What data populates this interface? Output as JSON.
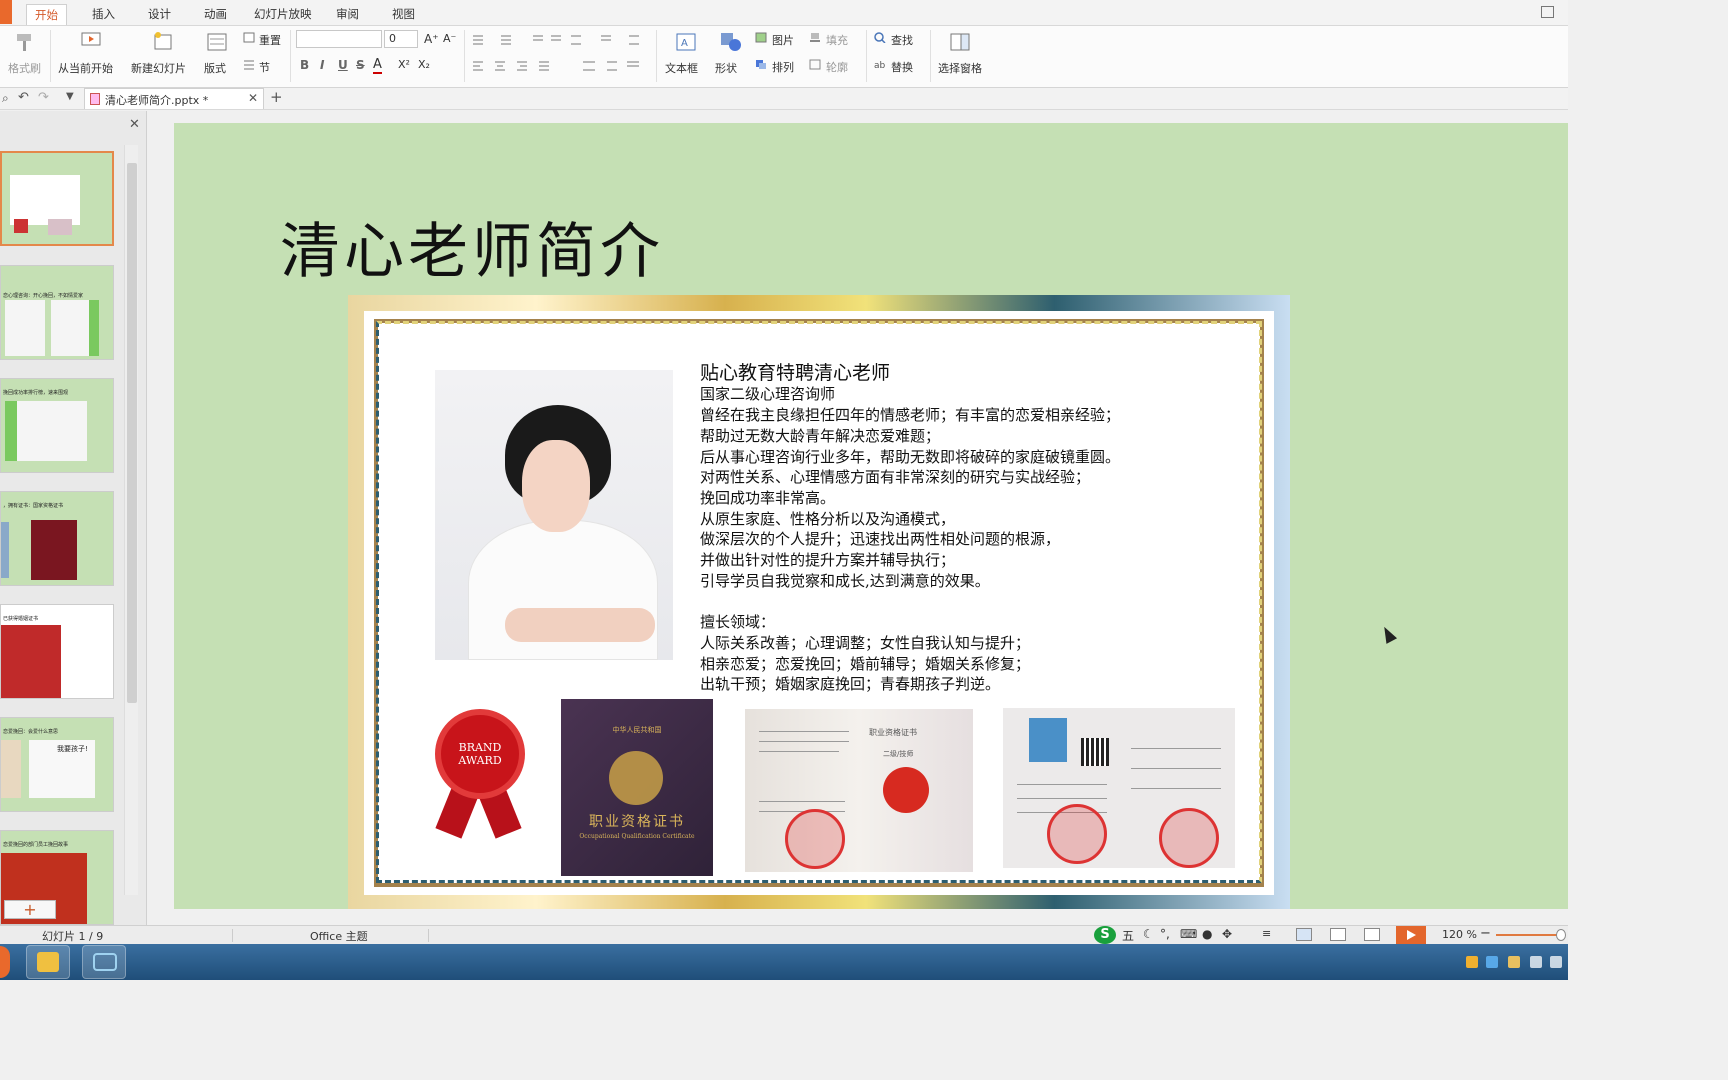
{
  "menubar": {
    "tabs": [
      "开始",
      "插入",
      "设计",
      "动画",
      "幻灯片放映",
      "审阅",
      "视图"
    ],
    "active": "开始"
  },
  "ribbon": {
    "format_painter": "格式刷",
    "from_current": "从当前开始",
    "new_slide": "新建幻灯片",
    "layout": "版式",
    "reset": "重置",
    "section": "节",
    "font_size": "0",
    "bold": "B",
    "italic": "I",
    "underline": "U",
    "strike": "S",
    "textbox": "文本框",
    "shape": "形状",
    "picture": "图片",
    "fill": "填充",
    "arrange": "排列",
    "outline": "轮廓",
    "find": "查找",
    "replace": "替换",
    "selection_pane": "选择窗格"
  },
  "document": {
    "tab_name": "清心老师简介.pptx *"
  },
  "thumbnails": [
    {
      "caption": ""
    },
    {
      "caption": "恋心理咨询：开心挽回，不如情爱家"
    },
    {
      "caption": "挽回成功率排行榜，速来围观"
    },
    {
      "caption": "，拥有证书：国家资格证书"
    },
    {
      "caption": "已获得婚姻证书"
    },
    {
      "caption": "恋爱挽回：会爱什么意思"
    },
    {
      "caption": "恋爱挽回的部门员工挽回故事"
    }
  ],
  "thumb_bubble": "我要孩子!",
  "slide": {
    "title": "清心老师简介",
    "intro_heading": "贴心教育特聘清心老师",
    "intro_lines": [
      "国家二级心理咨询师",
      "曾经在我主良缘担任四年的情感老师；有丰富的恋爱相亲经验；",
      "帮助过无数大龄青年解决恋爱难题；",
      "后从事心理咨询行业多年，帮助无数即将破碎的家庭破镜重圆。",
      "对两性关系、心理情感方面有非常深刻的研究与实战经验；",
      "挽回成功率非常高。",
      "从原生家庭、性格分析以及沟通模式，",
      "做深层次的个人提升；迅速找出两性相处问题的根源，",
      "并做出针对性的提升方案并辅导执行；",
      "引导学员自我觉察和成长,达到满意的效果。"
    ],
    "skills_title": "擅长领域：",
    "skills_lines": [
      "人际关系改善；心理调整；女性自我认知与提升；",
      "相亲恋爱；恋爱挽回；婚前辅导；婚姻关系修复；",
      "出轨干预；婚姻家庭挽回；青春期孩子判逆。"
    ],
    "award_line1": "BRAND",
    "award_line2": "AWARD",
    "book_top": "中华人民共和国",
    "book_title": "职业资格证书",
    "book_en": "Occupational Qualification Certificate",
    "cert_title": "职业资格证书",
    "cert_level": "二级/技师"
  },
  "statusbar": {
    "slide_counter": "幻灯片 1 / 9",
    "theme": "Office 主题",
    "ime_logo": "S",
    "ime_mode": "五",
    "zoom": "120 %"
  },
  "colors": {
    "accent": "#e3662c",
    "slide_bg": "#c5e0b4"
  }
}
